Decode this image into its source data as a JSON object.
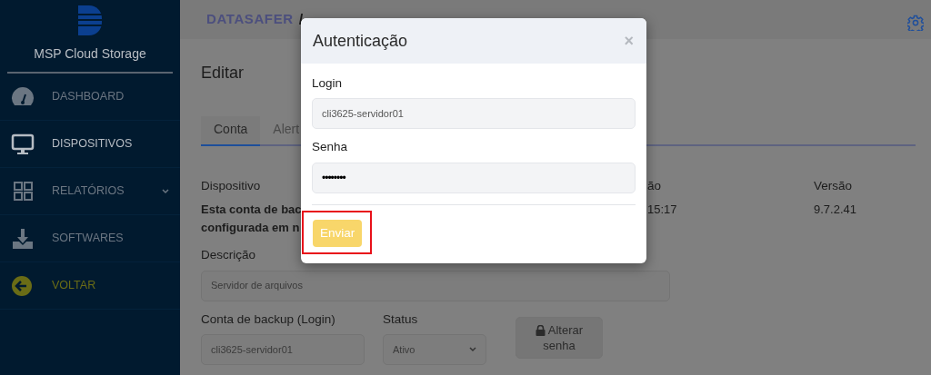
{
  "sidebar": {
    "brand": "MSP Cloud Storage",
    "items": [
      {
        "label": "DASHBOARD",
        "kind": "gauge",
        "selected": false,
        "expandable": false
      },
      {
        "label": "DISPOSITIVOS",
        "kind": "monitor",
        "selected": true,
        "expandable": false
      },
      {
        "label": "RELATÓRIOS",
        "kind": "grid",
        "selected": false,
        "expandable": true
      },
      {
        "label": "SOFTWARES",
        "kind": "download",
        "selected": false,
        "expandable": false
      },
      {
        "label": "VOLTAR",
        "kind": "back",
        "selected": false,
        "expandable": false
      }
    ]
  },
  "header": {
    "breadcrumb": [
      "DATASAFER",
      "/"
    ]
  },
  "page": {
    "title": "Editar",
    "tabs": [
      {
        "label": "Conta",
        "selected": true
      },
      {
        "label": "Alert",
        "selected": false
      }
    ],
    "info": [
      {
        "label": "Dispositivo",
        "lines": [
          "Esta conta de bac",
          "configurada em n"
        ]
      },
      {
        "label": "ão",
        "lines": [
          "15:17"
        ]
      },
      {
        "label": "Versão",
        "lines": [
          "9.7.2.41"
        ]
      }
    ],
    "description": {
      "label": "Descrição",
      "value": "Servidor de arquivos"
    },
    "backup_login": {
      "label": "Conta de backup (Login)",
      "value": "cli3625-servidor01"
    },
    "status": {
      "label": "Status",
      "value": "Ativo"
    },
    "change_password_button": "Alterar senha"
  },
  "modal": {
    "title": "Autenticação",
    "close": "×",
    "fields": [
      {
        "label": "Login",
        "value": "cli3625-servidor01",
        "kind": "text"
      },
      {
        "label": "Senha",
        "value": "••••••••",
        "kind": "password"
      }
    ],
    "submit": {
      "label": "Enviar",
      "highlighted": true
    }
  }
}
